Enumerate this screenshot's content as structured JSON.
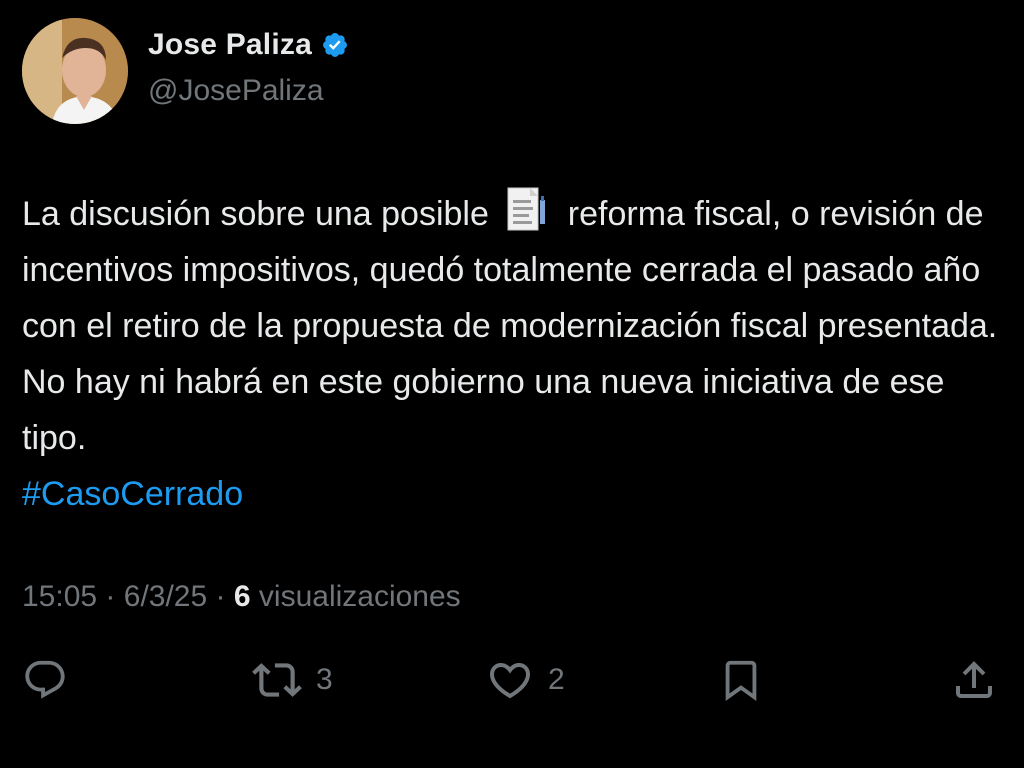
{
  "author": {
    "display_name": "Jose Paliza",
    "handle": "@JosePaliza",
    "verified_icon": "verified-badge-icon",
    "verified_color": "#1d9bf0"
  },
  "tweet": {
    "text_part1": "La discusión sobre una posible",
    "emoji_icon": "document-emoji-icon",
    "text_part2": "reforma fiscal, o revisión de incentivos impositivos, quedó totalmente cerrada el pasado año con el retiro de la propuesta de modernización fiscal presentada. No hay ni habrá en este gobierno una nueva iniciativa de ese tipo.",
    "hashtag": "#CasoCerrado",
    "hashtag_color": "#1d9bf0"
  },
  "meta": {
    "time": "15:05",
    "separator": "·",
    "date": "6/3/25",
    "views_count": "6",
    "views_label": "visualizaciones"
  },
  "actions": {
    "reply": {
      "icon": "reply-icon",
      "count": ""
    },
    "retweet": {
      "icon": "retweet-icon",
      "count": "3"
    },
    "like": {
      "icon": "heart-icon",
      "count": "2"
    },
    "bookmark": {
      "icon": "bookmark-icon",
      "count": ""
    },
    "share": {
      "icon": "share-icon",
      "count": ""
    }
  },
  "colors": {
    "background": "#000000",
    "text": "#e7e9ea",
    "secondary": "#71767b",
    "accent": "#1d9bf0"
  }
}
